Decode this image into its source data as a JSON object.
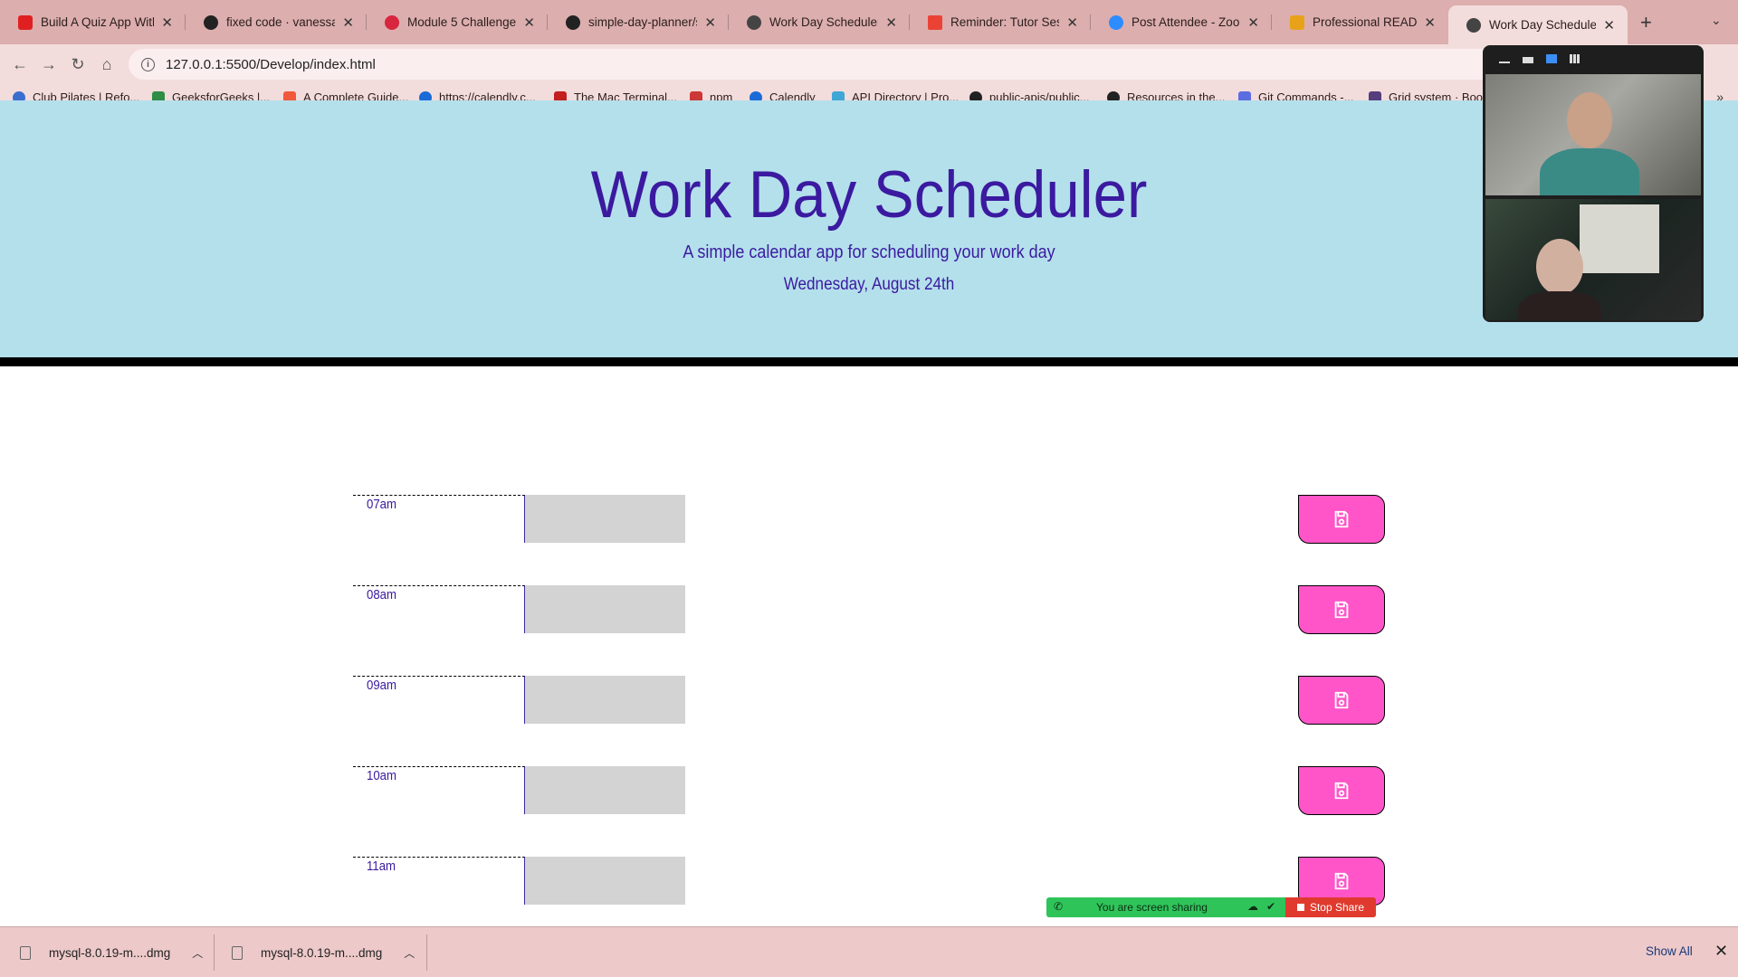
{
  "browser": {
    "tabs": [
      {
        "title": "Build A Quiz App With J",
        "favicon_color": "#e02020"
      },
      {
        "title": "fixed code · vanessaja",
        "favicon_color": "#222222"
      },
      {
        "title": "Module 5 Challenge",
        "favicon_color": "#d7263d"
      },
      {
        "title": "simple-day-planner/scr",
        "favicon_color": "#222222"
      },
      {
        "title": "Work Day Scheduler",
        "favicon_color": "#444444"
      },
      {
        "title": "Reminder: Tutor Sessio",
        "favicon_color": "#ea4335"
      },
      {
        "title": "Post Attendee - Zoom",
        "favicon_color": "#2d8cff"
      },
      {
        "title": "Professional README G",
        "favicon_color": "#e8a21a"
      },
      {
        "title": "Work Day Scheduler",
        "favicon_color": "#444444",
        "active": true
      }
    ],
    "url": "127.0.0.1:5500/Develop/index.html",
    "bookmarks": [
      "Club Pilates | Refo...",
      "GeeksforGeeks |...",
      "A Complete Guide...",
      "https://calendly.c...",
      "The Mac Terminal...",
      "npm",
      "Calendly",
      "API Directory | Pro...",
      "public-apis/public...",
      "Resources in the...",
      "Git Commands -...",
      "Grid system · Boo..."
    ]
  },
  "page": {
    "title": "Work Day Scheduler",
    "subtitle": "A simple calendar app for scheduling your work day",
    "current_day": "Wednesday, August 24th",
    "time_blocks": [
      {
        "hour": "07am",
        "text": ""
      },
      {
        "hour": "08am",
        "text": ""
      },
      {
        "hour": "09am",
        "text": ""
      },
      {
        "hour": "10am",
        "text": ""
      },
      {
        "hour": "11am",
        "text": ""
      }
    ],
    "colors": {
      "header_bg": "#b4e0ec",
      "title_color": "#3b1aa0",
      "save_button": "#ff55c8",
      "past_block": "#d3d3d3"
    }
  },
  "downloads": {
    "items": [
      "mysql-8.0.19-m....dmg",
      "mysql-8.0.19-m....dmg"
    ],
    "show_all": "Show All"
  },
  "zoom": {
    "sharing_text": "You are screen sharing",
    "stop_label": "Stop Share"
  }
}
